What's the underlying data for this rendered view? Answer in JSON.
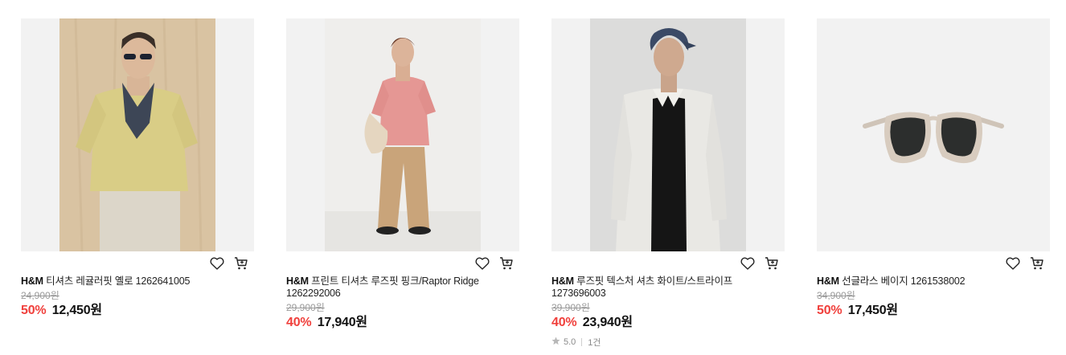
{
  "colors": {
    "discount": "#f0403c",
    "muted": "#9a9a9a",
    "thumb_bg": "#f2f2f2"
  },
  "icons": {
    "wishlist": "heart-icon",
    "cart": "cart-icon",
    "rating": "star-icon"
  },
  "products": [
    {
      "brand": "H&M",
      "name": "티셔츠 레귤러핏 옐로 1262641005",
      "original_price": "24,900원",
      "discount_rate": "50%",
      "sale_price": "12,450원"
    },
    {
      "brand": "H&M",
      "name": "프린트 티셔츠 루즈핏 핑크/Raptor Ridge 1262292006",
      "original_price": "29,900원",
      "discount_rate": "40%",
      "sale_price": "17,940원"
    },
    {
      "brand": "H&M",
      "name": "루즈핏 텍스처 셔츠 화이트/스트라이프 1273696003",
      "original_price": "39,900원",
      "discount_rate": "40%",
      "sale_price": "23,940원",
      "rating": "5.0",
      "review_count": "1건"
    },
    {
      "brand": "H&M",
      "name": "선글라스 베이지 1261538002",
      "original_price": "34,900원",
      "discount_rate": "50%",
      "sale_price": "17,450원"
    }
  ]
}
